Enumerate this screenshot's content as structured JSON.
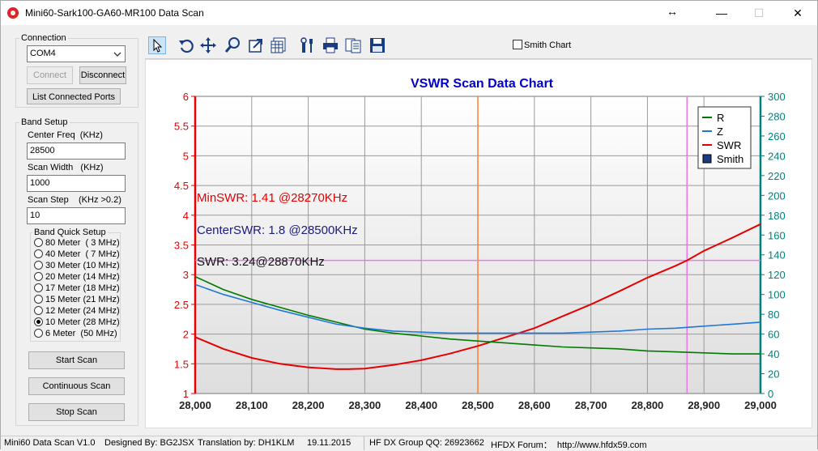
{
  "window": {
    "title": "Mini60-Sark100-GA60-MR100 Data Scan",
    "resize_glyph": "↔",
    "min": "—",
    "max": "☐",
    "close": "✕"
  },
  "connection": {
    "group_label": "Connection",
    "port": "COM4",
    "connect": "Connect",
    "disconnect": "Disconnect",
    "list_ports": "List Connected Ports"
  },
  "band_setup": {
    "group_label": "Band Setup",
    "center_label": "Center Freq  (KHz)",
    "center_value": "28500",
    "width_label": "Scan Width   (KHz)",
    "width_value": "1000",
    "step_label": "Scan Step",
    "step_hint": "(KHz >0.2)",
    "step_value": "10"
  },
  "quick": {
    "group_label": "Band Quick Setup",
    "bands": [
      "80 Meter  ( 3 MHz)",
      "40 Meter  ( 7 MHz)",
      "30 Meter (10 MHz)",
      "20 Meter (14 MHz)",
      "17 Meter (18 MHz)",
      "15 Meter (21 MHz)",
      "12 Meter (24 MHz)",
      "10 Meter (28 MHz)",
      "6 Meter  (50 MHz)"
    ],
    "selected": 7
  },
  "buttons": {
    "start": "Start Scan",
    "continuous": "Continuous Scan",
    "stop": "Stop Scan"
  },
  "toolbar": {
    "icons": [
      "pointer-icon",
      "undo-icon",
      "pan-icon",
      "zoom-icon",
      "export-icon",
      "table-icon",
      "tools-icon",
      "print-icon",
      "copy-icon",
      "save-icon"
    ],
    "smith_label": "Smith Chart",
    "smith_checked": false
  },
  "status": {
    "app": "Mini60 Data Scan V1.0",
    "designed": "Designed By: BG2JSX",
    "translation": "Translation by: DH1KLM",
    "date": "19.11.2015",
    "group": "HF DX Group QQ: 26923662",
    "forum": "HFDX Forum：  http://www.hfdx59.com"
  },
  "colors": {
    "swr": "#e60000",
    "r": "#007a00",
    "z": "#1f78d2",
    "center_line": "#ff7f2a",
    "cursor_line": "#ee77ee",
    "left_axis": "#e60000",
    "right_axis": "#008080",
    "title": "#0000cc"
  },
  "chart_data": {
    "type": "line",
    "title": "VSWR Scan Data Chart",
    "xlim": [
      28000,
      29000
    ],
    "x_ticks": [
      28000,
      28100,
      28200,
      28300,
      28400,
      28500,
      28600,
      28700,
      28800,
      28900,
      29000
    ],
    "x_tick_labels": [
      "28,000",
      "28,100",
      "28,200",
      "28,300",
      "28,400",
      "28,500",
      "28,600",
      "28,700",
      "28,800",
      "28,900",
      "29,000"
    ],
    "ylim_left": [
      1,
      6
    ],
    "y_ticks_left": [
      "1",
      "1.5",
      "2",
      "2.5",
      "3",
      "3.5",
      "4",
      "4.5",
      "5",
      "5.5",
      "6"
    ],
    "ylim_right": [
      0,
      300
    ],
    "y_ticks_right": [
      "0",
      "20",
      "40",
      "60",
      "80",
      "100",
      "120",
      "140",
      "160",
      "180",
      "200",
      "220",
      "240",
      "260",
      "280",
      "300"
    ],
    "legend": [
      "R",
      "Z",
      "SWR",
      "Smith"
    ],
    "legend_position": "top-right",
    "annotations": {
      "min_swr": "MinSWR: 1.41 @28270KHz",
      "center_swr": "CenterSWR: 1.8 @28500KHz",
      "cursor_swr": "SWR: 3.24@28870KHz"
    },
    "center_freq": 28500,
    "cursor": {
      "x": 28870,
      "swr": 3.24
    },
    "series": [
      {
        "name": "SWR",
        "axis": "left",
        "x": [
          28000,
          28050,
          28100,
          28150,
          28200,
          28250,
          28270,
          28300,
          28350,
          28400,
          28450,
          28500,
          28550,
          28600,
          28650,
          28700,
          28750,
          28800,
          28850,
          28870,
          28900,
          28950,
          29000
        ],
        "values": [
          1.95,
          1.75,
          1.6,
          1.5,
          1.44,
          1.41,
          1.41,
          1.42,
          1.48,
          1.56,
          1.67,
          1.8,
          1.95,
          2.1,
          2.3,
          2.5,
          2.72,
          2.95,
          3.15,
          3.24,
          3.4,
          3.62,
          3.85
        ]
      },
      {
        "name": "R",
        "axis": "right",
        "x": [
          28000,
          28050,
          28100,
          28150,
          28200,
          28250,
          28300,
          28350,
          28400,
          28450,
          28500,
          28550,
          28600,
          28650,
          28700,
          28750,
          28800,
          28850,
          28900,
          28950,
          29000
        ],
        "values": [
          118,
          105,
          95,
          87,
          79,
          72,
          65,
          61,
          58,
          55,
          53,
          51,
          49,
          47,
          46,
          45,
          43,
          42,
          41,
          40,
          40
        ]
      },
      {
        "name": "Z",
        "axis": "right",
        "x": [
          28000,
          28050,
          28100,
          28150,
          28200,
          28250,
          28300,
          28350,
          28400,
          28450,
          28500,
          28550,
          28600,
          28650,
          28700,
          28750,
          28800,
          28850,
          28900,
          28950,
          29000
        ],
        "values": [
          110,
          100,
          92,
          84,
          77,
          70,
          66,
          63,
          62,
          61,
          61,
          61,
          61,
          61,
          62,
          63,
          65,
          66,
          68,
          70,
          72
        ]
      }
    ]
  }
}
